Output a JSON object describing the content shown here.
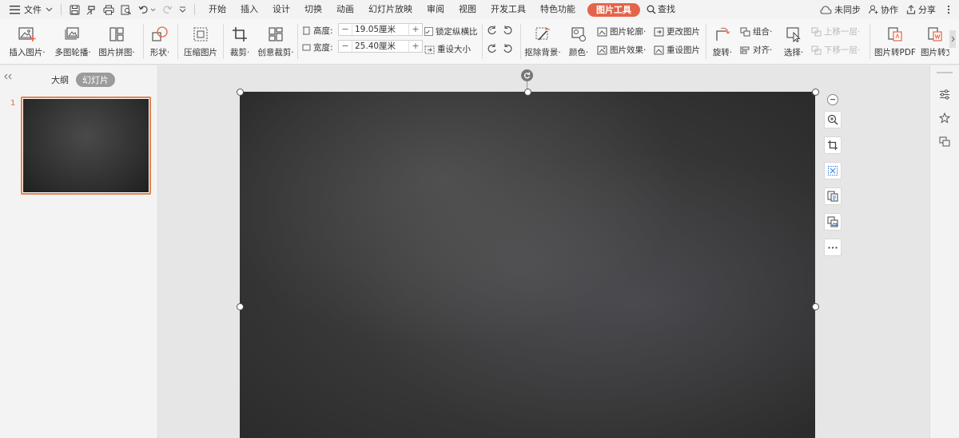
{
  "menubar": {
    "file_label": "文件",
    "tabs": [
      "开始",
      "插入",
      "设计",
      "切换",
      "动画",
      "幻灯片放映",
      "审阅",
      "视图",
      "开发工具",
      "特色功能",
      "图片工具"
    ],
    "active_tab": "图片工具",
    "search_label": "查找",
    "sync_label": "未同步",
    "collab_label": "协作",
    "share_label": "分享"
  },
  "ribbon": {
    "insert_picture": "插入图片·",
    "multi_carousel": "多图轮播·",
    "picture_collage": "图片拼图·",
    "shape": "形状·",
    "compress": "压缩图片",
    "crop": "裁剪·",
    "creative_crop": "创意裁剪·",
    "height_label": "高度:",
    "height_value": "19.05厘米",
    "width_label": "宽度:",
    "width_value": "25.40厘米",
    "lock_ratio": "锁定纵横比",
    "reset_size": "重设大小",
    "remove_bg": "抠除背景·",
    "color": "颜色·",
    "outline": "图片轮廓·",
    "effects": "图片效果·",
    "change_picture": "更改图片",
    "reset_picture": "重设图片",
    "rotate": "旋转·",
    "group": "组合·",
    "align": "对齐·",
    "select": "选择·",
    "bring_forward": "上移一层·",
    "send_backward": "下移一层·",
    "to_pdf": "图片转PDF",
    "to_text": "图片转文"
  },
  "leftpanel": {
    "outline_tab": "大纲",
    "slides_tab": "幻灯片",
    "slide_number": "1"
  },
  "colors": {
    "accent": "#e4644b",
    "thumb_border": "#e4844b"
  }
}
